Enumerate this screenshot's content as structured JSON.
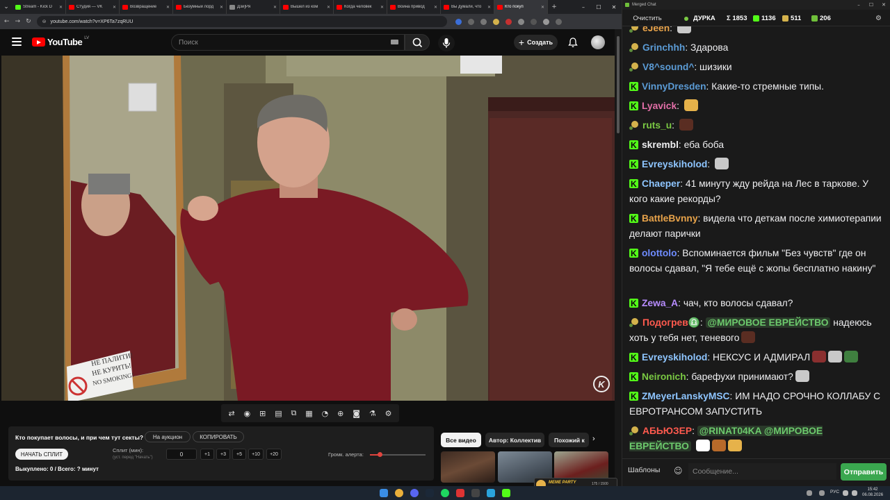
{
  "browser": {
    "tabs": [
      {
        "title": "Stream - Kick D",
        "color": "#53fc18"
      },
      {
        "title": "Студия — VK",
        "color": "#ff0000"
      },
      {
        "title": "Возвращение",
        "color": "#ff0000"
      },
      {
        "title": "Безумный лорд",
        "color": "#ff0000"
      },
      {
        "title": "Дзи]Ря",
        "color": "#888888"
      },
      {
        "title": "Вышел из ком",
        "color": "#ff0000"
      },
      {
        "title": "Когда человек",
        "color": "#ff0000"
      },
      {
        "title": "Война привод",
        "color": "#ff0000"
      },
      {
        "title": "Вы думали, что",
        "color": "#ff0000"
      },
      {
        "title": "Кто покуп",
        "color": "#ff0000"
      }
    ],
    "new_tab": "+",
    "url": "youtube.com/watch?v=XP6Ta7zqRUU"
  },
  "youtube": {
    "logo_text": "YouTube",
    "region": "LV",
    "search_placeholder": "Поиск",
    "create_label": "Создать"
  },
  "video": {
    "sign_lines": [
      "НЕ ПАЛИТИ!",
      "НЕ КУРИТЬ!",
      "NO SMOKING!"
    ],
    "watermark": "K"
  },
  "toolbar_icons": [
    "loop-icon",
    "broadcast-icon",
    "translate-icon",
    "clapper-icon",
    "resize-icon",
    "subtitles-icon",
    "speed-icon",
    "add-icon",
    "camera-icon",
    "flask-icon",
    "gear-icon"
  ],
  "ext_panel": {
    "question": "Кто покупает волосы, и при чем тут секты?",
    "auction_label": "На аукцион",
    "copy_label": "КОПИРОВАТЬ",
    "split_button": "НАЧАТЬ СПЛИТ",
    "split_label": "Сплит (мин):",
    "split_hint": "(уст. перед \"Начать\")",
    "split_value": "0",
    "steps": [
      "+1",
      "+3",
      "+5",
      "+10",
      "+20"
    ],
    "alert_label": "Громк. алерта:",
    "alert_volume": 0.18,
    "total": "Выкуплено: 0 / Всего: ? минут"
  },
  "chips": {
    "all": "Все видео",
    "author": "Автор: Коллектив",
    "similar": "Похожий к"
  },
  "meme_party": {
    "label": "MEME PARTY",
    "count": "175 / 1500"
  },
  "chat": {
    "window_title": "Merged Chat",
    "clear_label": "Очистить",
    "stream_name": "ДУРКА",
    "total": "Σ 1853",
    "kick_count": "1136",
    "twitch_count": "511",
    "other_count": "206",
    "templates_label": "Шаблоны",
    "input_placeholder": "Сообщение...",
    "send_label": "Отправить",
    "messages": [
      {
        "platform": "tw",
        "user": "eJeeh",
        "color": "#e8a34a",
        "text": "",
        "emotes": 1
      },
      {
        "platform": "tw",
        "user": "Grinchhh",
        "color": "#5b9bd5",
        "text": "Здарова",
        "emotes": 0
      },
      {
        "platform": "tw",
        "user": "V8^sound^",
        "color": "#5b9bd5",
        "text": "шизики",
        "emotes": 0
      },
      {
        "platform": "kick",
        "user": "VinnyDresden",
        "color": "#5b9bd5",
        "text": "Какие-то стремные типы.",
        "emotes": 0
      },
      {
        "platform": "kick",
        "user": "Lyavick",
        "color": "#e36fa8",
        "text": "",
        "emotes": 1
      },
      {
        "platform": "tw",
        "user": "ruts_u",
        "color": "#7ac943",
        "text": "",
        "emotes": 1
      },
      {
        "platform": "kick",
        "user": "skrembl",
        "color": "#efeff1",
        "text": "еба боба",
        "emotes": 0
      },
      {
        "platform": "kick",
        "user": "Evreyskiholod",
        "color": "#8ec5ff",
        "text": "",
        "emotes": 1
      },
      {
        "platform": "kick",
        "user": "Chaeper",
        "color": "#8ec5ff",
        "text": "41 минуту жду рейда на Лес в таркове. У кого какие рекорды?",
        "emotes": 0
      },
      {
        "platform": "kick",
        "user": "BattleBvnny",
        "color": "#e8a34a",
        "text": "видела что деткам после химиотерапии делают парички",
        "emotes": 0
      },
      {
        "platform": "kick",
        "user": "olottolo",
        "color": "#6f8cff",
        "text": "Вспоминается фильм \"Без чувств\" где он волосы сдавал, \"Я тебе ещё с жопы бесплатно накину\"",
        "emotes": 0
      },
      {
        "platform": "kick",
        "user": "Zewa_A",
        "color": "#b78cff",
        "text": "чач, кто волосы сдавал?",
        "emotes": 0
      },
      {
        "platform": "tw",
        "user": "Подогрев♎",
        "color": "#ff5a4e",
        "mention": "@МИРОВОЕ ЕВРЕЙСТВО",
        "text": "надеюсь хоть у тебя нет, теневого",
        "emotes": 1
      },
      {
        "platform": "kick",
        "user": "Evreyskiholod",
        "color": "#8ec5ff",
        "text": "НЕКСУС И АДМИРАЛ",
        "emotes": 3
      },
      {
        "platform": "kick",
        "user": "Neironich",
        "color": "#7ac943",
        "text": "барефухи принимают?",
        "emotes": 1
      },
      {
        "platform": "kick",
        "user": "ZMeyerLanskyMSC",
        "color": "#8ec5ff",
        "text": "ИМ НАДО СРОЧНО КОЛЛАБУ С ЕВРОТРАНСОМ ЗАПУСТИТЬ",
        "emotes": 0
      },
      {
        "platform": "tw",
        "user": "АБЬЮЗЕР",
        "color": "#ff5a4e",
        "mention": "@RINAT04KA @МИРОВОЕ ЕВРЕЙСТВО",
        "text": "",
        "emotes": 3
      }
    ]
  },
  "taskbar": {
    "lang": "РУС",
    "time": "15:42",
    "date": "06.08.2026"
  }
}
